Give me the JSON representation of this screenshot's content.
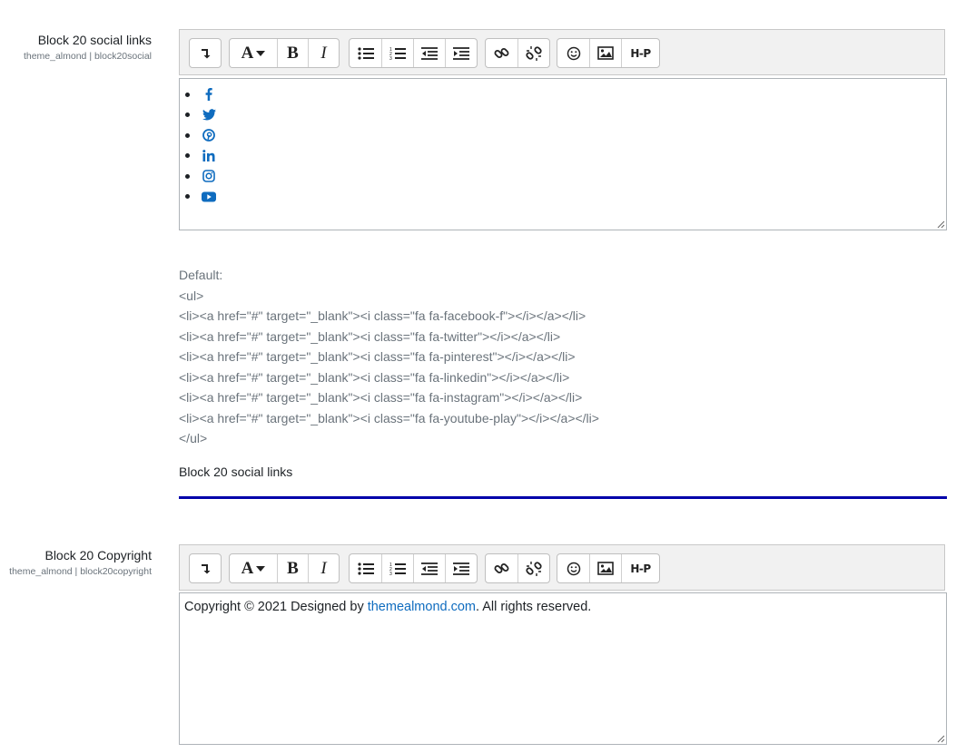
{
  "setting1": {
    "label": "Block 20 social links",
    "sublabel": "theme_almond | block20social",
    "icons": [
      "facebook-icon",
      "twitter-icon",
      "pinterest-icon",
      "linkedin-icon",
      "instagram-icon",
      "youtube-icon"
    ],
    "default_heading": "Default:",
    "default_lines": [
      "<ul>",
      "<li><a href=\"#\" target=\"_blank\"><i class=\"fa fa-facebook-f\"></i></a></li>",
      "<li><a href=\"#\" target=\"_blank\"><i class=\"fa fa-twitter\"></i></a></li>",
      "<li><a href=\"#\" target=\"_blank\"><i class=\"fa fa-pinterest\"></i></a></li>",
      "<li><a href=\"#\" target=\"_blank\"><i class=\"fa fa-linkedin\"></i></a></li>",
      "<li><a href=\"#\" target=\"_blank\"><i class=\"fa fa-instagram\"></i></a></li>",
      "<li><a href=\"#\" target=\"_blank\"><i class=\"fa fa-youtube-play\"></i></a></li>",
      "</ul>"
    ],
    "description": "Block 20 social links"
  },
  "setting2": {
    "label": "Block 20 Copyright",
    "sublabel": "theme_almond | block20copyright",
    "content_prefix": "Copyright © 2021 Designed by ",
    "content_link": "themealmond.com",
    "content_suffix": ". All rights reserved."
  },
  "toolbar": {
    "font_button": "A",
    "bold_button": "B",
    "italic_button": "I",
    "h5p_button": "H-P"
  },
  "colors": {
    "accent": "#0f6cbf",
    "divider": "#0000aa"
  }
}
